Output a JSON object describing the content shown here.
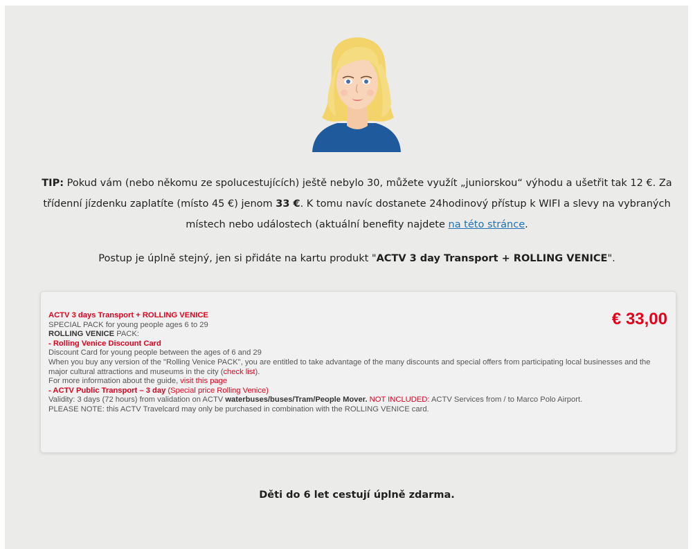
{
  "tip": {
    "label": "TIP:",
    "text_1": " Pokud vám (nebo někomu ze spolucestujících) ještě nebylo 30, můžete využít „juniorskou“ výhodu a ušetřit tak 12 €. Za třídenní jízdenku zaplatíte (místo 45 €) jenom ",
    "price": "33 €",
    "text_2": ". K tomu navíc dostanete 24hodinový přístup k WIFI a slevy na vybraných místech nebo událostech (aktuální benefity najdete ",
    "link": "na této stránce",
    "text_3": "."
  },
  "postup": {
    "text_1": "Postup je úplně stejný, jen si přidáte na kartu produkt \"",
    "product": "ACTV 3 day Transport + ROLLING VENICE",
    "text_2": "\"."
  },
  "card": {
    "title": "ACTV 3 days Transport + ROLLING VENICE",
    "price": "€ 33,00",
    "subtitle": "SPECIAL PACK for young people ages 6 to 29",
    "pack_bold": "ROLLING VENICE",
    "pack_rest": " PACK:",
    "discount_prefix": "- ",
    "discount_title": "Rolling Venice Discount Card",
    "discount_desc": "Discount Card for young people between the ages of 6 and 29",
    "when_buy": "When you buy any version of the \"Rolling Venice PACK\", you are entitled to take advantage of the many discounts and special offers from participating local businesses and the major cultural attractions and museums in the city (",
    "check_list": "check list",
    "when_buy_end": ").",
    "more_info": "For more information about the guide, ",
    "visit_page": "visit this page",
    "transport_prefix": "- ",
    "transport_title": "ACTV Public Transport – 3 day",
    "transport_special": " (Special price Rolling Venice)",
    "validity": "Validity: 3 days (72 hours) from validation on ACTV ",
    "validity_bold": "waterbuses/buses/Tram/People Mover.",
    "not_included_label": " NOT INCLUDED:",
    "not_included_text": " ACTV Services from / to Marco Polo Airport.",
    "note": "PLEASE NOTE: this ACTV Travelcard may only be purchased in combination with the ROLLING VENICE card."
  },
  "kids": "Děti do 6 let cestují úplně zdarma.",
  "colors": {
    "accent_red": "#e3001b",
    "link_blue": "#1f6fb5",
    "panel_bg": "#ebece9"
  },
  "avatar_icon": "woman-avatar-icon"
}
